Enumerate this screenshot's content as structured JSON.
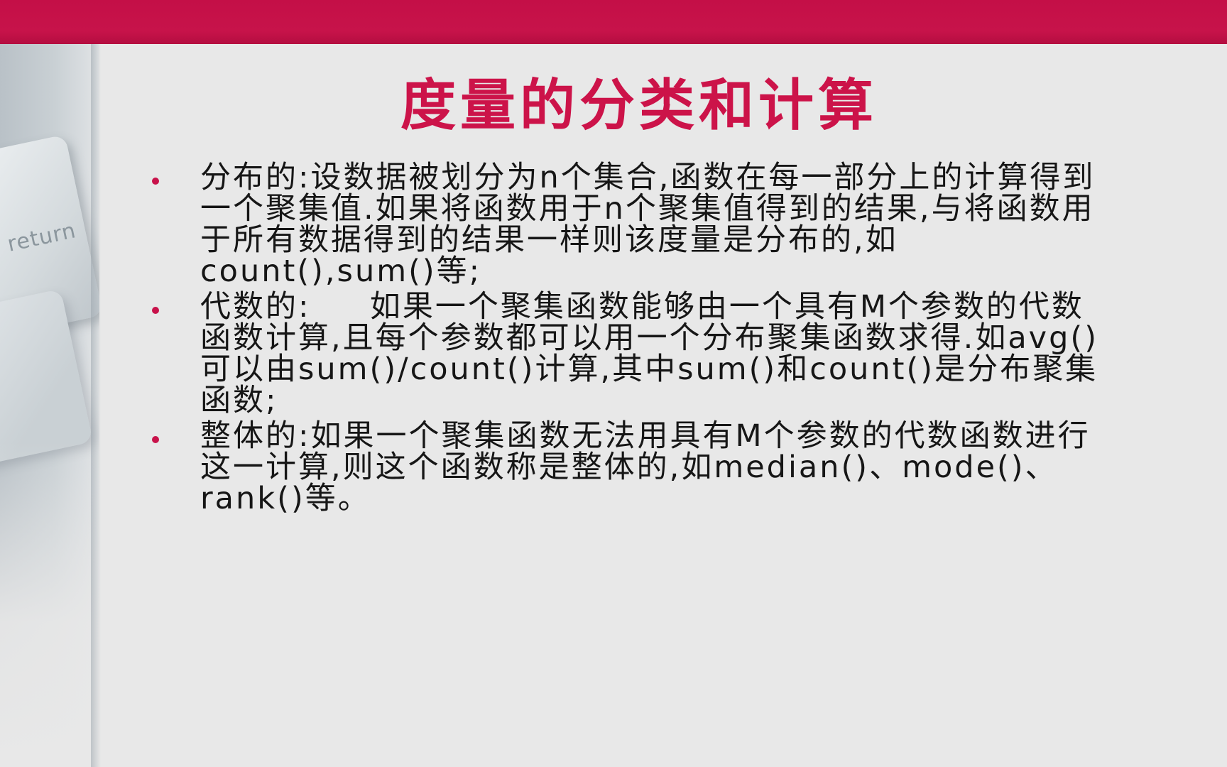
{
  "slide": {
    "side_key_label": "return",
    "title": "度量的分类和计算",
    "bullets": [
      "分布的:设数据被划分为n个集合,函数在每一部分上的计算得到一个聚集值.如果将函数用于n个聚集值得到的结果,与将函数用于所有数据得到的结果一样则该度量是分布的,如count(),sum()等;",
      "代数的:     如果一个聚集函数能够由一个具有M个参数的代数函数计算,且每个参数都可以用一个分布聚集函数求得.如avg()可以由sum()/count()计算,其中sum()和count()是分布聚集函数;",
      "整体的:如果一个聚集函数无法用具有M个参数的代数函数进行这一计算,则这个函数称是整体的,如median()、mode()、rank()等。"
    ]
  },
  "colors": {
    "accent": "#c8124a",
    "title": "#cc1349",
    "text": "#161616",
    "background": "#e8e8e8"
  }
}
